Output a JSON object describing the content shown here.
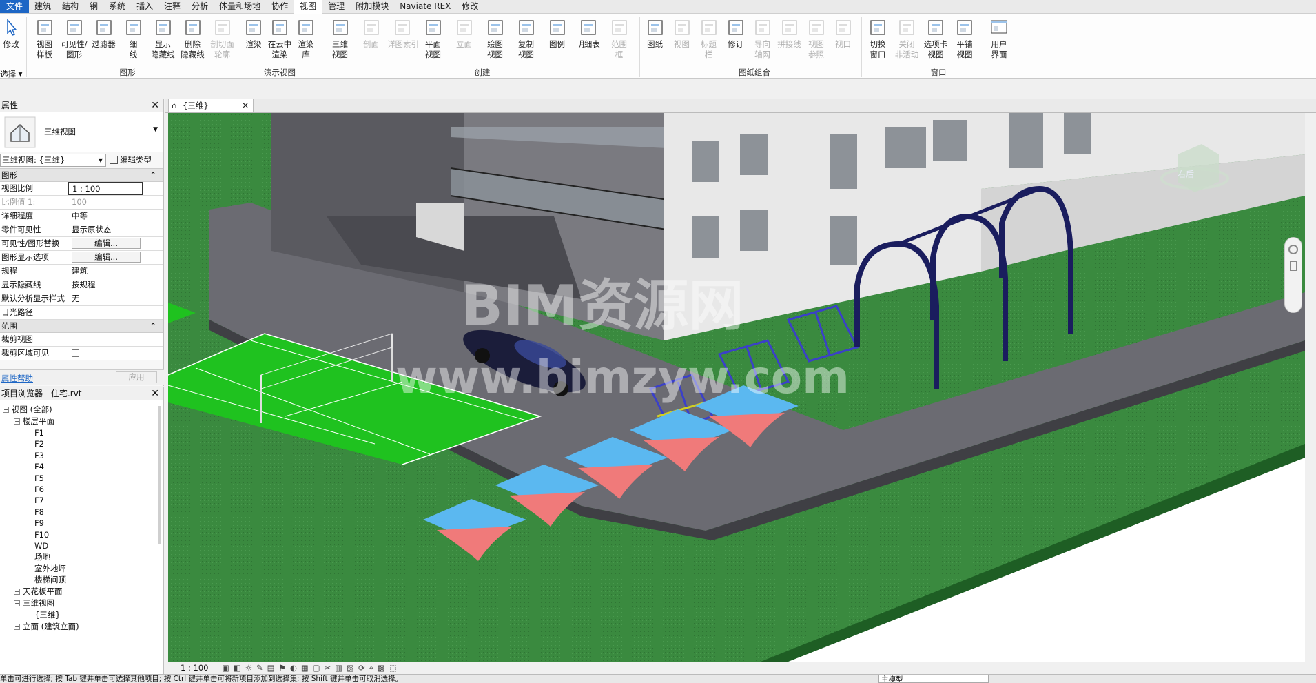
{
  "menu": {
    "tabs": [
      "文件",
      "建筑",
      "结构",
      "钢",
      "系统",
      "插入",
      "注释",
      "分析",
      "体量和场地",
      "协作",
      "视图",
      "管理",
      "附加模块",
      "Naviate REX",
      "修改"
    ],
    "active": "视图"
  },
  "ribbon": {
    "select": {
      "modify": "修改",
      "select_label": "选择 ▾"
    },
    "graphics": {
      "label": "图形",
      "buttons": [
        {
          "l1": "视图",
          "l2": "样板"
        },
        {
          "l1": "可见性/",
          "l2": "图形"
        },
        {
          "l1": "过滤器",
          "l2": ""
        },
        {
          "l1": "细",
          "l2": "线"
        },
        {
          "l1": "显示",
          "l2": "隐藏线"
        },
        {
          "l1": "删除",
          "l2": "隐藏线"
        },
        {
          "l1": "剖切面",
          "l2": "轮廓"
        }
      ]
    },
    "presentation": {
      "label": "演示视图",
      "buttons": [
        {
          "l1": "渲染",
          "l2": ""
        },
        {
          "l1": "在云中",
          "l2": "渲染"
        },
        {
          "l1": "渲染",
          "l2": "库"
        }
      ]
    },
    "create": {
      "label": "创建",
      "buttons": [
        {
          "l1": "三维",
          "l2": "视图"
        },
        {
          "l1": "剖面",
          "l2": ""
        },
        {
          "l1": "详图索引",
          "l2": ""
        },
        {
          "l1": "平面",
          "l2": "视图"
        },
        {
          "l1": "立面",
          "l2": ""
        },
        {
          "l1": "绘图",
          "l2": "视图"
        },
        {
          "l1": "复制",
          "l2": "视图"
        },
        {
          "l1": "图例",
          "l2": ""
        },
        {
          "l1": "明细表",
          "l2": ""
        },
        {
          "l1": "范围",
          "l2": "框"
        }
      ]
    },
    "sheet": {
      "label": "图纸组合",
      "buttons": [
        {
          "l1": "图纸",
          "l2": ""
        },
        {
          "l1": "视图",
          "l2": ""
        },
        {
          "l1": "标题",
          "l2": "栏"
        },
        {
          "l1": "修订",
          "l2": ""
        },
        {
          "l1": "导向",
          "l2": "轴网"
        },
        {
          "l1": "拼接线",
          "l2": ""
        },
        {
          "l1": "视图",
          "l2": "参照"
        },
        {
          "l1": "视口",
          "l2": ""
        }
      ]
    },
    "windows": {
      "label": "窗口",
      "buttons": [
        {
          "l1": "切换",
          "l2": "窗口"
        },
        {
          "l1": "关闭",
          "l2": "非活动"
        },
        {
          "l1": "选项卡",
          "l2": "视图"
        },
        {
          "l1": "平铺",
          "l2": "视图"
        }
      ]
    },
    "ui": {
      "l1": "用户",
      "l2": "界面"
    }
  },
  "properties": {
    "title": "属性",
    "type_name": "三维视图",
    "selector": "三维视图: {三维}",
    "edit_type": "编辑类型",
    "sec_graphics": "图形",
    "rows": [
      {
        "k": "视图比例",
        "v": "1 : 100"
      },
      {
        "k": "比例值 1:",
        "v": "100"
      },
      {
        "k": "详细程度",
        "v": "中等"
      },
      {
        "k": "零件可见性",
        "v": "显示原状态"
      },
      {
        "k": "可见性/图形替换",
        "v": "编辑..."
      },
      {
        "k": "图形显示选项",
        "v": "编辑..."
      },
      {
        "k": "规程",
        "v": "建筑"
      },
      {
        "k": "显示隐藏线",
        "v": "按规程"
      },
      {
        "k": "默认分析显示样式",
        "v": "无"
      },
      {
        "k": "日光路径",
        "v": ""
      }
    ],
    "sec_range": "范围",
    "rows2": [
      {
        "k": "裁剪视图",
        "v": ""
      },
      {
        "k": "裁剪区域可见",
        "v": ""
      }
    ],
    "help": "属性帮助",
    "apply": "应用"
  },
  "browser": {
    "title": "项目浏览器 - 住宅.rvt",
    "root": "视图 (全部)",
    "floor_plans": "楼层平面",
    "floors": [
      "F1",
      "F2",
      "F3",
      "F4",
      "F5",
      "F6",
      "F7",
      "F8",
      "F9",
      "F10",
      "WD",
      "场地",
      "室外地坪",
      "楼梯间顶"
    ],
    "ceiling": "天花板平面",
    "three_d": "三维视图",
    "three_d_item": "{三维}",
    "elevation": "立面 (建筑立面)"
  },
  "view": {
    "tab": "{三维}",
    "scale": "1 : 100",
    "cube_label": "右后",
    "watermark1": "BIM资源网",
    "watermark2": "www.bimzyw.com"
  },
  "status": {
    "hint": "单击可进行选择; 按 Tab 键并单击可选择其他项目; 按 Ctrl 键并单击可将新项目添加到选择集; 按 Shift 键并单击可取消选择。",
    "model": "主模型"
  },
  "colors": {
    "accent": "#1d66c5",
    "grass": "#3a8a3f",
    "road": "#6b6b72",
    "court": "#1fc21f",
    "table": "#5bb8f0",
    "tableLeg": "#f07a7a"
  }
}
